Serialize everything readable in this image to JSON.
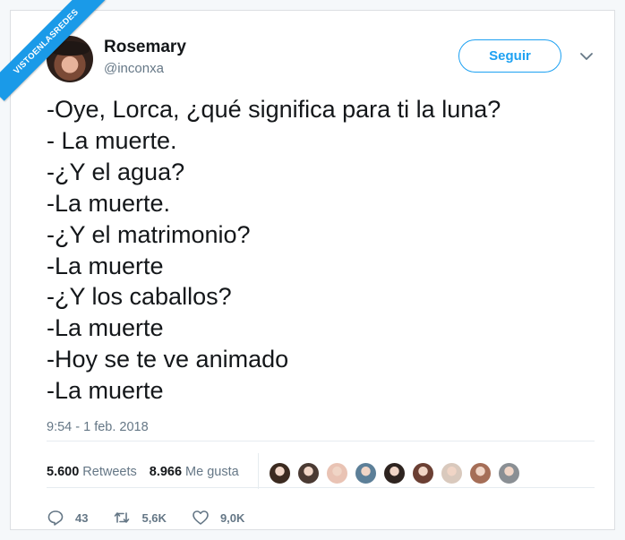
{
  "watermark": "VISTOENLASREDES",
  "user": {
    "name": "Rosemary",
    "handle": "@inconxa"
  },
  "follow_label": "Seguir",
  "tweet": {
    "lines": [
      "-Oye, Lorca, ¿qué significa para ti la luna?",
      "- La muerte.",
      "-¿Y el agua?",
      "-La muerte.",
      "-¿Y el matrimonio?",
      "-La muerte",
      "-¿Y los caballos?",
      "-La muerte",
      "-Hoy se te ve animado",
      "-La muerte"
    ],
    "timestamp": "9:54 - 1 feb. 2018"
  },
  "stats": {
    "retweets_count": "5.600",
    "retweets_label": "Retweets",
    "likes_count": "8.966",
    "likes_label": "Me gusta"
  },
  "likers": [
    "#3b2a20",
    "#4a3a33",
    "#e9c3b4",
    "#5c7f98",
    "#2e2420",
    "#6b3f33",
    "#d9c9bd",
    "#a56e57",
    "#8a8f94"
  ],
  "actions": {
    "replies": "43",
    "retweets": "5,6K",
    "likes": "9,0K"
  },
  "colors": {
    "accent": "#1da1f2",
    "secondary_text": "#657786",
    "watermark_bg": "#1a9ae8"
  }
}
